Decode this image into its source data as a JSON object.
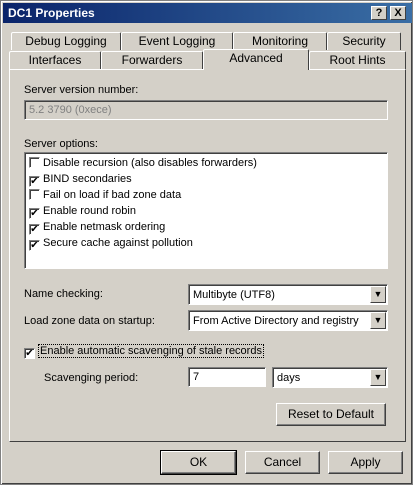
{
  "window": {
    "title": "DC1 Properties",
    "help_button": "?",
    "close_button": "X"
  },
  "tabs": {
    "back_row": [
      "Debug Logging",
      "Event Logging",
      "Monitoring",
      "Security"
    ],
    "front_row": [
      "Interfaces",
      "Forwarders",
      "Advanced",
      "Root Hints"
    ],
    "active": "Advanced"
  },
  "advanced": {
    "version_label": "Server version number:",
    "version_value": "5.2 3790 (0xece)",
    "options_label": "Server options:",
    "options": [
      {
        "label": "Disable recursion (also disables forwarders)",
        "checked": false
      },
      {
        "label": "BIND secondaries",
        "checked": true
      },
      {
        "label": "Fail on load if bad zone data",
        "checked": false
      },
      {
        "label": "Enable round robin",
        "checked": true
      },
      {
        "label": "Enable netmask ordering",
        "checked": true
      },
      {
        "label": "Secure cache against pollution",
        "checked": true
      }
    ],
    "name_checking_label": "Name checking:",
    "name_checking_value": "Multibyte (UTF8)",
    "load_zone_label": "Load zone data on startup:",
    "load_zone_value": "From Active Directory and registry",
    "scavenging_label": "Enable automatic scavenging of stale records",
    "scavenging_checked": true,
    "period_label": "Scavenging period:",
    "period_value": "7",
    "period_unit": "days",
    "reset_button": "Reset to Default"
  },
  "buttons": {
    "ok": "OK",
    "cancel": "Cancel",
    "apply": "Apply"
  }
}
